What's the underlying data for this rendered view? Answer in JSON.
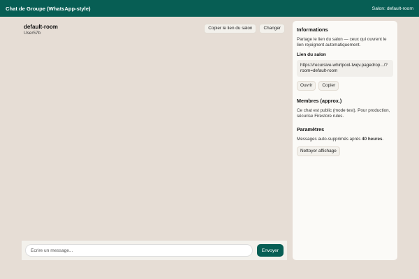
{
  "header": {
    "title": "Chat de Groupe (WhatsApp-style)",
    "room_label": "Salon: default-room"
  },
  "chat": {
    "room_name": "default-room",
    "user_name": "User57b",
    "copy_link_label": "Copier le lien du salon",
    "change_label": "Changer"
  },
  "composer": {
    "placeholder": "Écrire un message...",
    "value": "",
    "send_label": "Envoyer"
  },
  "sidebar": {
    "info_title": "Informations",
    "info_text": "Partage le lien du salon — ceux qui ouvrent le lien rejoignent automatiquement.",
    "link_title": "Lien du salon",
    "link_value": "https://recursive-whirlpool-twqv.pagedrop.../?room=default-room",
    "open_label": "Ouvrir",
    "copy_label": "Copier",
    "members_title": "Membres (approx.)",
    "members_text": "Ce chat est public (mode test). Pour production, sécurise Firestore rules.",
    "settings_title": "Paramètres",
    "settings_text_before": "Messages auto-supprimés après ",
    "settings_text_bold": "40 heures",
    "settings_text_after": ".",
    "clear_label": "Nettoyer affichage"
  },
  "colors": {
    "brand": "#075e54",
    "background": "#e6ddd5",
    "panel": "#fbfaf7"
  }
}
